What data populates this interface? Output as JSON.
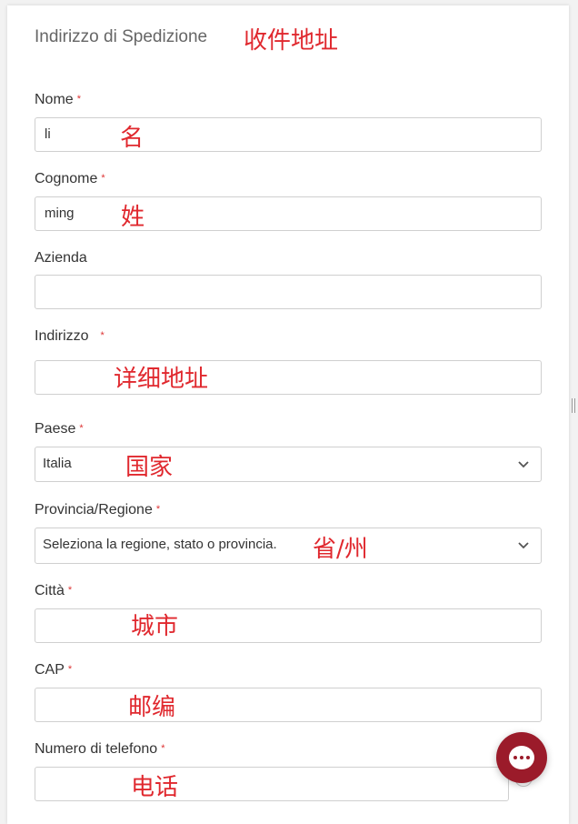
{
  "section": {
    "title": "Indirizzo di Spedizione",
    "title_annotation": "收件地址"
  },
  "required_marker": "*",
  "fields": {
    "first_name": {
      "label": "Nome",
      "value": "li",
      "annotation": "名",
      "required": true
    },
    "last_name": {
      "label": "Cognome",
      "value": "ming",
      "annotation": "姓",
      "required": true
    },
    "company": {
      "label": "Azienda",
      "value": "",
      "required": false
    },
    "address": {
      "label": "Indirizzo",
      "value": "",
      "annotation": "详细地址",
      "required": true
    },
    "country": {
      "label": "Paese",
      "value": "Italia",
      "annotation": "国家",
      "required": true
    },
    "province": {
      "label": "Provincia/Regione",
      "value": "Seleziona la regione, stato o provincia.",
      "annotation": "省/州",
      "required": true
    },
    "city": {
      "label": "Città",
      "value": "",
      "annotation": "城市",
      "required": true
    },
    "zip": {
      "label": "CAP",
      "value": "",
      "annotation": "邮编",
      "required": true
    },
    "phone": {
      "label": "Numero di telefono",
      "value": "",
      "annotation": "电话",
      "required": true
    }
  },
  "help_icon": {
    "glyph": "?",
    "icon": "question-circle-icon"
  },
  "chat_widget": {
    "icon": "chat-bubble-icon",
    "color": "#9b1b2a"
  },
  "colors": {
    "annotation": "#e0282e",
    "required": "#dd3333",
    "chat": "#9b1b2a"
  }
}
